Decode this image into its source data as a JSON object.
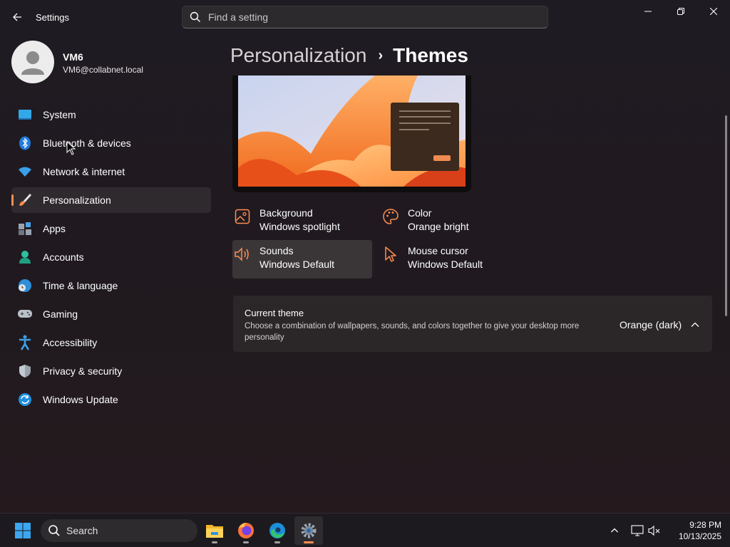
{
  "titlebar": {
    "app_title": "Settings",
    "search_placeholder": "Find a setting"
  },
  "profile": {
    "name": "VM6",
    "email": "VM6@collabnet.local"
  },
  "sidebar": {
    "items": [
      {
        "label": "System",
        "icon": "system-icon"
      },
      {
        "label": "Bluetooth & devices",
        "icon": "bluetooth-icon"
      },
      {
        "label": "Network & internet",
        "icon": "wifi-icon"
      },
      {
        "label": "Personalization",
        "icon": "brush-icon",
        "active": true
      },
      {
        "label": "Apps",
        "icon": "apps-icon"
      },
      {
        "label": "Accounts",
        "icon": "accounts-icon"
      },
      {
        "label": "Time & language",
        "icon": "globe-clock-icon"
      },
      {
        "label": "Gaming",
        "icon": "gamepad-icon"
      },
      {
        "label": "Accessibility",
        "icon": "accessibility-icon"
      },
      {
        "label": "Privacy & security",
        "icon": "shield-icon"
      },
      {
        "label": "Windows Update",
        "icon": "update-icon"
      }
    ]
  },
  "breadcrumb": {
    "parent": "Personalization",
    "separator": "›",
    "current": "Themes"
  },
  "theme_tiles": {
    "background": {
      "title": "Background",
      "value": "Windows spotlight"
    },
    "color": {
      "title": "Color",
      "value": "Orange bright"
    },
    "sounds": {
      "title": "Sounds",
      "value": "Windows Default"
    },
    "mouse_cursor": {
      "title": "Mouse cursor",
      "value": "Windows Default"
    }
  },
  "current_theme": {
    "title": "Current theme",
    "description": "Choose a combination of wallpapers, sounds, and colors together to give your desktop more personality",
    "value": "Orange (dark)"
  },
  "taskbar": {
    "search_label": "Search",
    "time": "9:28 PM",
    "date": "10/13/2025",
    "apps": [
      "file-explorer-icon",
      "firefox-icon",
      "edge-icon",
      "settings-icon"
    ]
  },
  "colors": {
    "accent": "#ff8c52",
    "background": "#201b20",
    "card": "#2b2729"
  }
}
